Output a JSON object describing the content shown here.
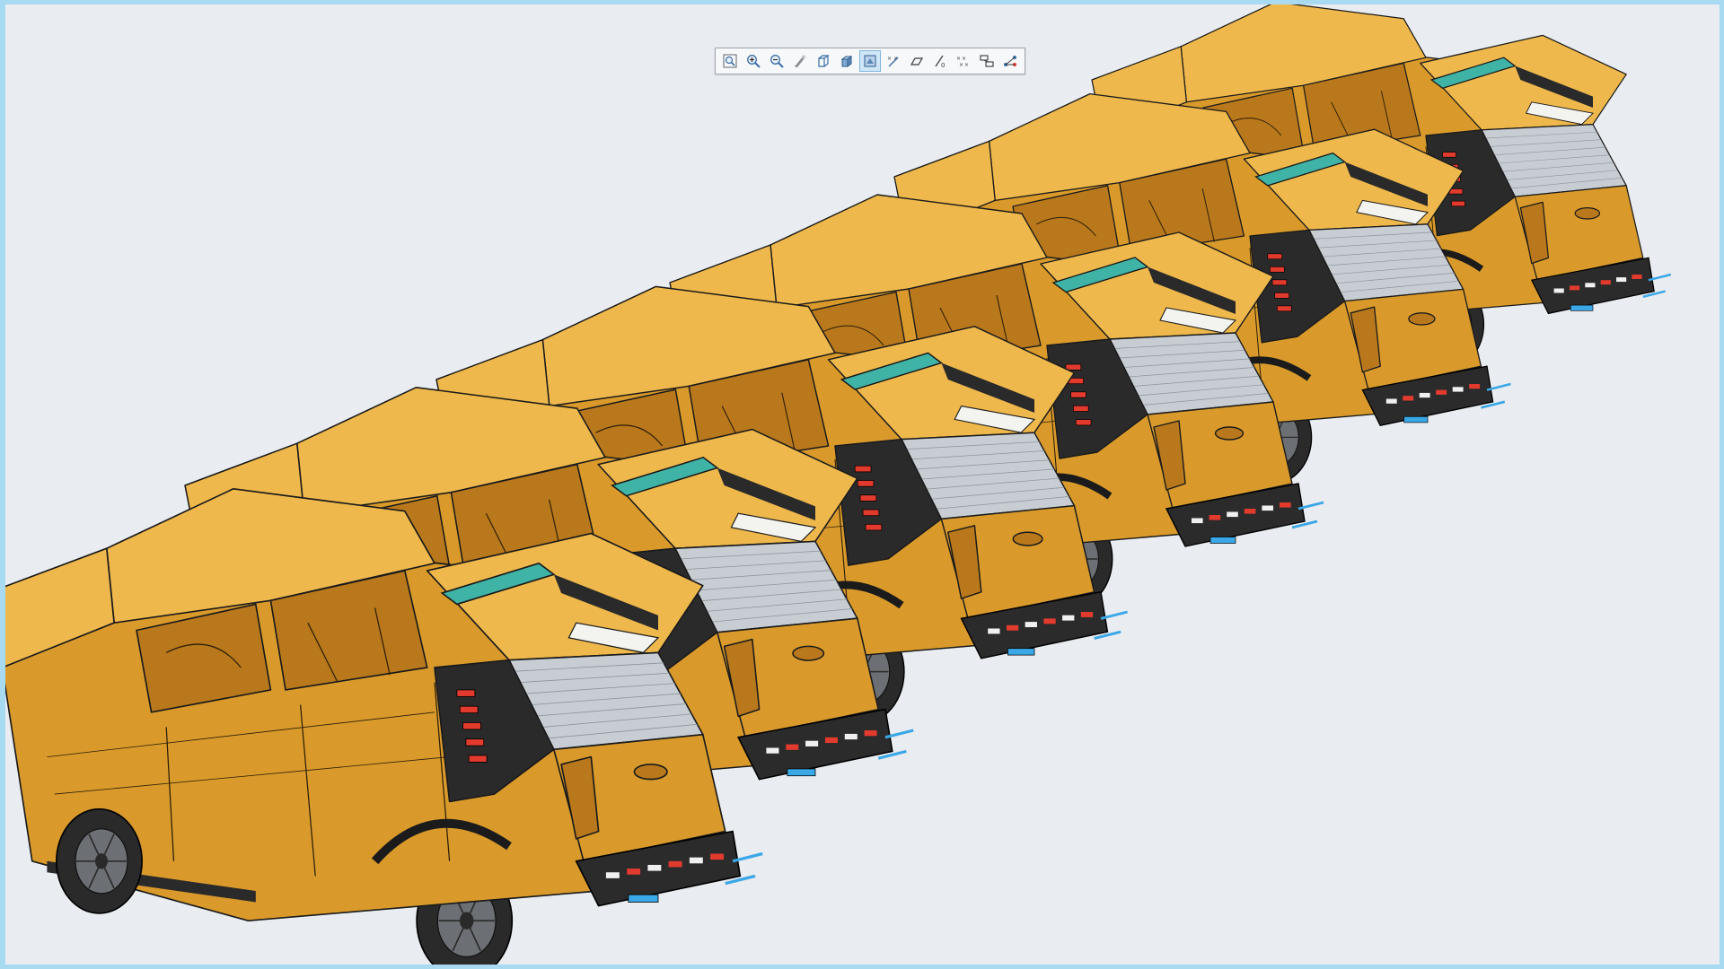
{
  "app": {
    "accent_border": "#a8daf2",
    "background": "#e9ecf1"
  },
  "model": {
    "body_color": "#d99a2b",
    "body_shadow": "#b9781b",
    "body_highlight": "#eeb84c",
    "edge_color": "#1a1a1a",
    "cover_color": "#c7cdd3",
    "accent_teal": "#3fb3a6",
    "accent_red": "#e23b2e",
    "accent_blue": "#3aa7e6",
    "tire_color": "#2a2a2a",
    "vehicle_count": 6
  },
  "toolbar": {
    "buttons": [
      {
        "name": "zoom-fit-icon",
        "active": false
      },
      {
        "name": "zoom-in-icon",
        "active": false
      },
      {
        "name": "zoom-out-icon",
        "active": false
      },
      {
        "name": "pan-icon",
        "active": false
      },
      {
        "name": "wireframe-box-icon",
        "active": false
      },
      {
        "name": "shaded-box-icon",
        "active": false
      },
      {
        "name": "shaded-edges-icon",
        "active": true
      },
      {
        "name": "hide-show-icon",
        "active": false
      },
      {
        "name": "plane-icon",
        "active": false
      },
      {
        "name": "axis-icon",
        "active": false
      },
      {
        "name": "points-icon",
        "active": false
      },
      {
        "name": "view-manager-icon",
        "active": false
      },
      {
        "name": "connect-icon",
        "active": false
      }
    ]
  }
}
